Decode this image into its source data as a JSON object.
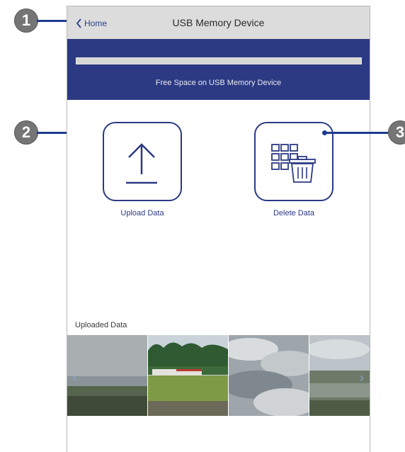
{
  "nav": {
    "back_label": "Home",
    "title": "USB Memory Device"
  },
  "storage": {
    "free_space_label": "Free Space on USB Memory Device",
    "used_fraction": 0.0
  },
  "actions": {
    "upload_label": "Upload Data",
    "delete_label": "Delete Data"
  },
  "uploaded": {
    "heading": "Uploaded Data",
    "prev_arrow": "‹",
    "next_arrow": "›"
  },
  "callouts": [
    "1",
    "2",
    "3"
  ],
  "colors": {
    "accent": "#2c3a83",
    "navbar": "#dcdcdc",
    "callout": "#757575"
  }
}
